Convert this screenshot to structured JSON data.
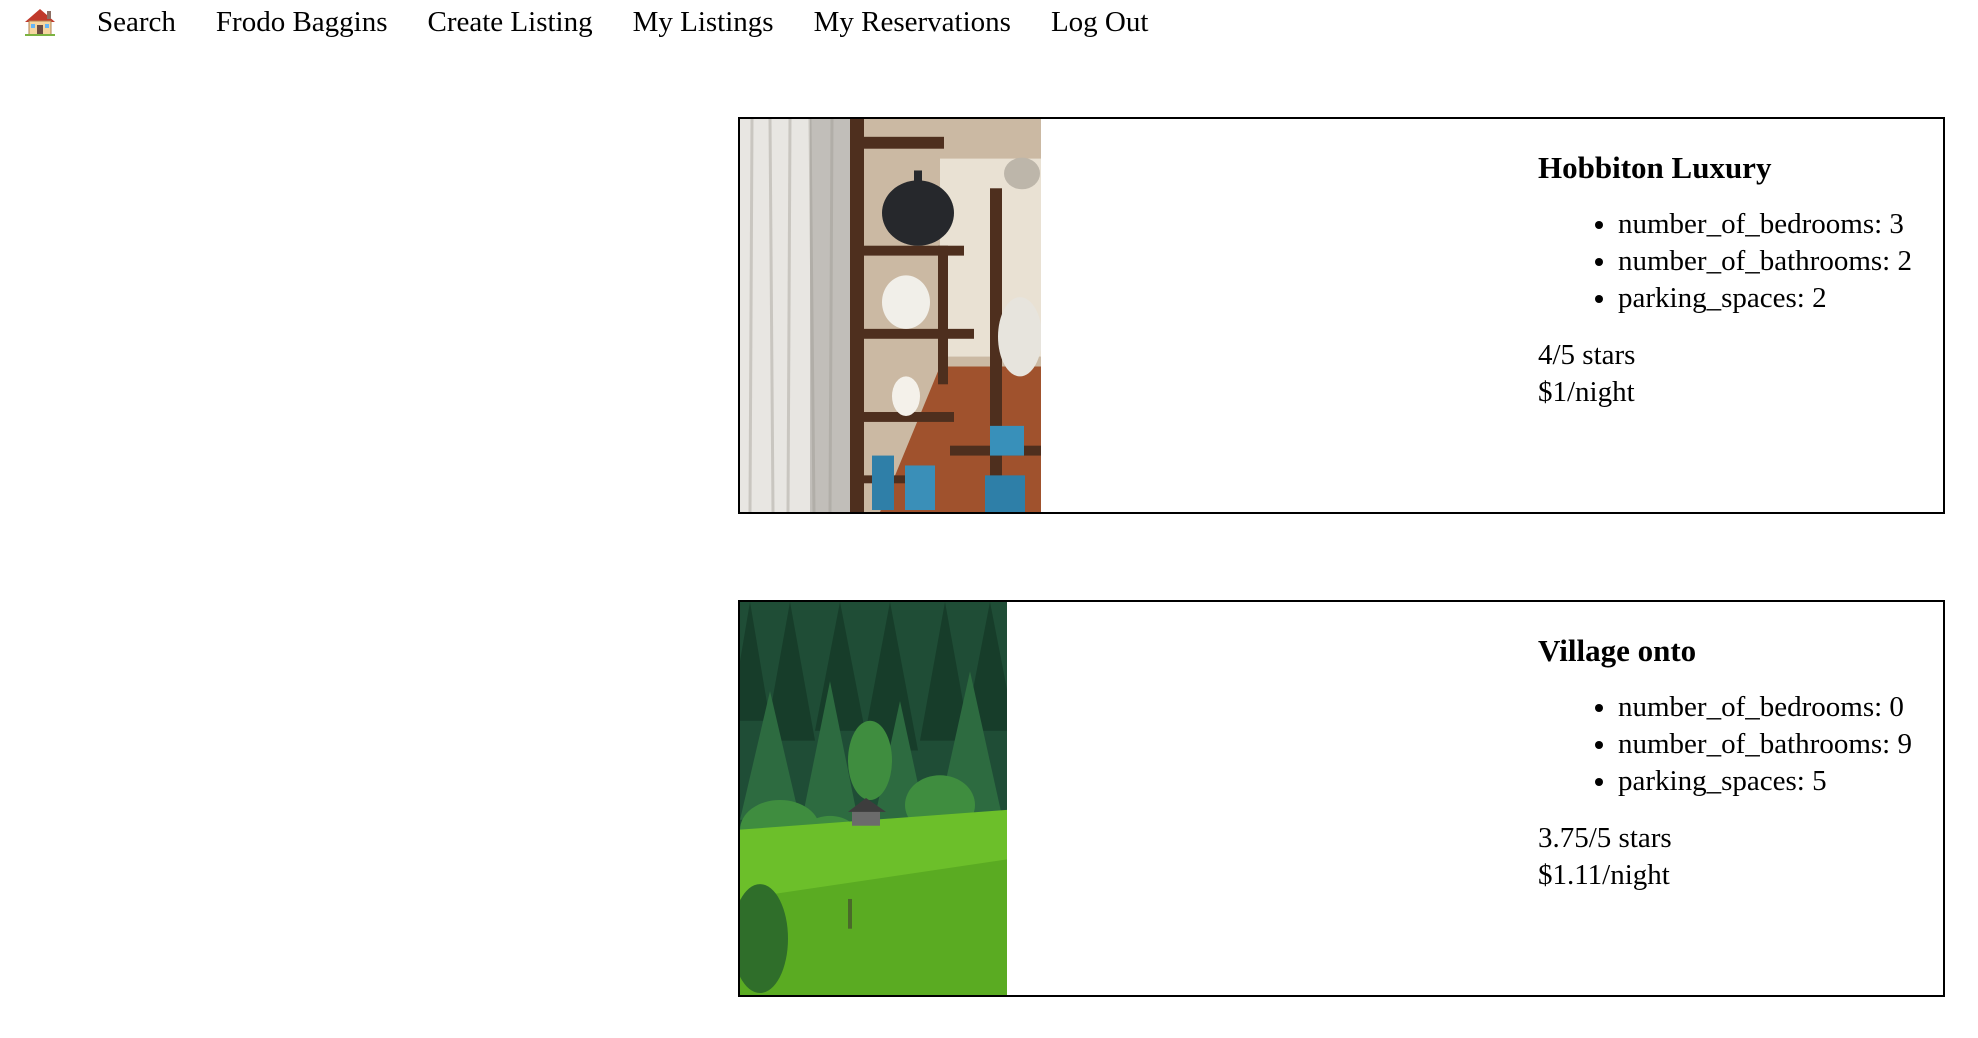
{
  "nav": {
    "home_icon": "house-emoji-icon",
    "links": [
      {
        "label": "Search"
      },
      {
        "label": "Frodo Baggins"
      },
      {
        "label": "Create Listing"
      },
      {
        "label": "My Listings"
      },
      {
        "label": "My Reservations"
      },
      {
        "label": "Log Out"
      }
    ]
  },
  "listings": [
    {
      "title": "Hobbiton Luxury",
      "features": [
        "number_of_bedrooms: 3",
        "number_of_bathrooms: 2",
        "parking_spaces: 2"
      ],
      "rating": "4/5 stars",
      "price": "$1/night",
      "image": "interior-shelves-vases-photo"
    },
    {
      "title": "Village onto",
      "features": [
        "number_of_bedrooms: 0",
        "number_of_bathrooms: 9",
        "parking_spaces: 5"
      ],
      "rating": "3.75/5 stars",
      "price": "$1.11/night",
      "image": "forest-cabin-meadow-photo"
    }
  ],
  "colors": {
    "border": "#000000",
    "text": "#000000",
    "background": "#ffffff"
  }
}
